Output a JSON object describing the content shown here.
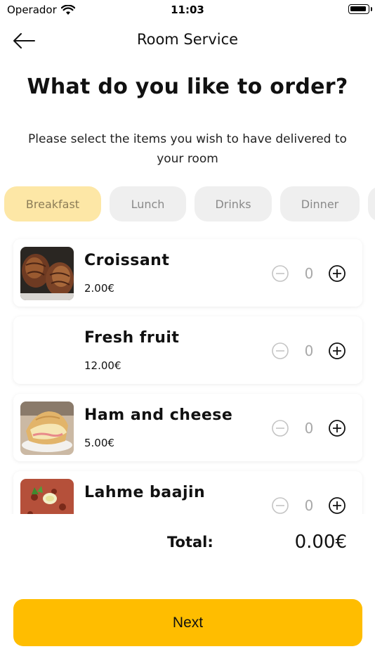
{
  "status_bar": {
    "carrier": "Operador",
    "time": "11:03"
  },
  "nav": {
    "title": "Room Service",
    "back_icon": "arrow-left-icon"
  },
  "heading": "What do you like to order?",
  "subheading": "Please select the items you wish to have delivered to your room",
  "tabs": [
    {
      "label": "Breakfast",
      "active": true
    },
    {
      "label": "Lunch",
      "active": false
    },
    {
      "label": "Drinks",
      "active": false
    },
    {
      "label": "Dinner",
      "active": false
    }
  ],
  "items": [
    {
      "name": "Croissant",
      "price": "2.00€",
      "quantity": "0",
      "image": "croissant-photo"
    },
    {
      "name": "Fresh fruit",
      "price": "12.00€",
      "quantity": "0",
      "image": ""
    },
    {
      "name": "Ham and cheese",
      "price": "5.00€",
      "quantity": "0",
      "image": "ham-and-cheese-photo"
    },
    {
      "name": "Lahme baajin",
      "price": "",
      "quantity": "0",
      "image": "lahme-baajin-photo"
    }
  ],
  "total": {
    "label": "Total:",
    "value": "0.00€"
  },
  "next_label": "Next",
  "colors": {
    "accent": "#ffbd00",
    "tab_active_bg": "#fde7a6",
    "tab_bg": "#efefef"
  }
}
